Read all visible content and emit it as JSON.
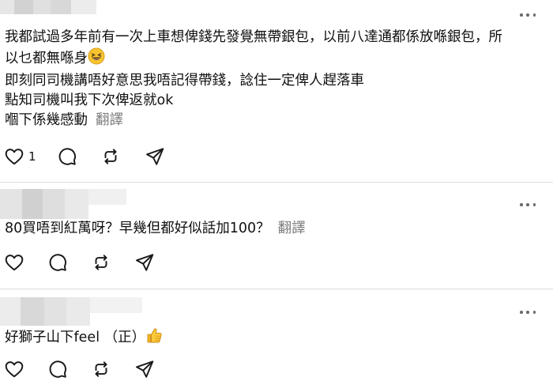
{
  "comments": [
    {
      "lines": [
        "我都試過多年前有一次上車想俾錢先發覺無帶銀包，以前八達通都係放喺銀包，所",
        "以乜都無喺身",
        "即刻同司機講唔好意思我唔記得帶錢，諗住一定俾人趕落車",
        "點知司機叫我下次俾返就ok"
      ],
      "last_line": "嗰下係幾感動",
      "translate_label": "翻譯",
      "like_count": "1",
      "icons": [
        "heart-icon",
        "comment-icon",
        "repost-icon",
        "share-icon",
        "more-icon",
        "grinning-squint-emoji"
      ]
    },
    {
      "last_line": "80買唔到紅萬呀？早幾但都好似話加100？",
      "translate_label": "翻譯",
      "like_count": "",
      "icons": [
        "heart-icon",
        "comment-icon",
        "repost-icon",
        "share-icon",
        "more-icon"
      ]
    },
    {
      "last_line": "好獅子山下feel （正）",
      "like_count": "",
      "icons": [
        "heart-icon",
        "comment-icon",
        "repost-icon",
        "share-icon",
        "more-icon",
        "thumbs-up-emoji"
      ]
    }
  ],
  "colors": {
    "text": "#101010",
    "muted": "#7a7a7a",
    "divider": "#dcdcdc",
    "icon": "#1a1a1a"
  }
}
